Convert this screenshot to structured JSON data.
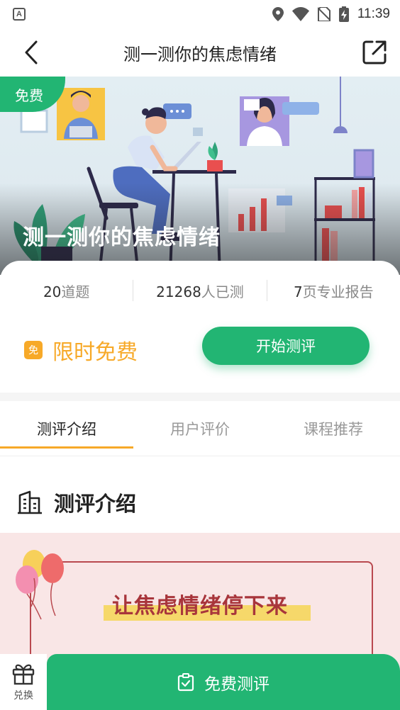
{
  "status_bar": {
    "time": "11:39",
    "left_icon": "a-icon"
  },
  "nav": {
    "title": "测一测你的焦虑情绪",
    "back_icon": "chevron-left-icon",
    "share_icon": "share-external-icon"
  },
  "banner": {
    "tag": "免费",
    "title": "测一测你的焦虑情绪"
  },
  "stats": [
    {
      "value": "20",
      "unit": "道题"
    },
    {
      "value": "21268",
      "unit": "人已测"
    },
    {
      "value": "7",
      "unit": "页专业报告"
    }
  ],
  "offer": {
    "badge": "免",
    "text": "限时免费",
    "start_button": "开始测评"
  },
  "tabs": [
    {
      "label": "测评介绍",
      "active": true
    },
    {
      "label": "用户评价",
      "active": false
    },
    {
      "label": "课程推荐",
      "active": false
    }
  ],
  "section": {
    "title": "测评介绍",
    "icon": "building-icon"
  },
  "poster": {
    "headline": "让焦虑情绪停下来"
  },
  "bottom_bar": {
    "exchange_label": "兑换",
    "free_test_label": "免费测评"
  },
  "colors": {
    "primary_green": "#22b573",
    "accent_orange": "#f7a928",
    "poster_red": "#a8353b"
  }
}
